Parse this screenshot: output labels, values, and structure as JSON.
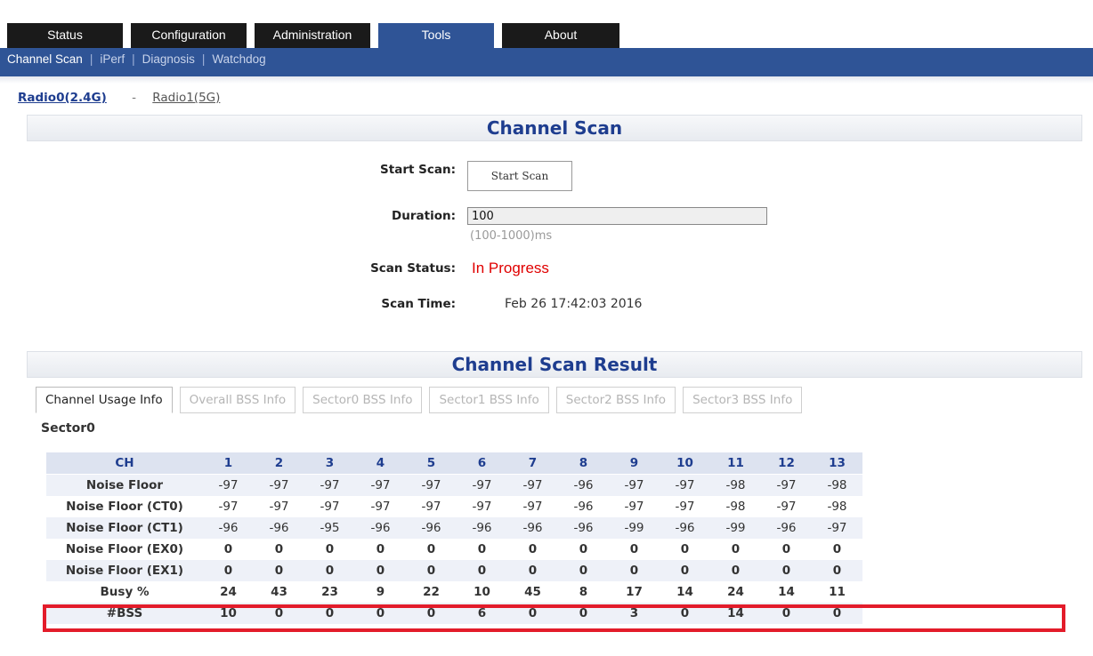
{
  "nav": {
    "tabs": [
      {
        "label": "Status"
      },
      {
        "label": "Configuration"
      },
      {
        "label": "Administration"
      },
      {
        "label": "Tools"
      },
      {
        "label": "About"
      }
    ],
    "active_tab": "Tools",
    "subnav": [
      "Channel Scan",
      "iPerf",
      "Diagnosis",
      "Watchdog"
    ],
    "subnav_sep": "|"
  },
  "radios": {
    "radio0": "Radio0(2.4G)",
    "sep": "-",
    "radio1": "Radio1(5G)"
  },
  "scan": {
    "header": "Channel Scan",
    "start_label": "Start Scan:",
    "start_button": "Start Scan",
    "duration_label": "Duration:",
    "duration_value": "100",
    "duration_hint": "(100-1000)ms",
    "status_label": "Scan Status:",
    "status_value": "In Progress",
    "time_label": "Scan Time:",
    "time_value": "Feb 26 17:42:03 2016"
  },
  "result": {
    "header": "Channel Scan Result",
    "tabs": [
      "Channel Usage Info",
      "Overall BSS Info",
      "Sector0 BSS Info",
      "Sector1 BSS Info",
      "Sector2 BSS Info",
      "Sector3 BSS Info"
    ],
    "sector": "Sector0",
    "table": {
      "header_label": "CH",
      "channels": [
        "1",
        "2",
        "3",
        "4",
        "5",
        "6",
        "7",
        "8",
        "9",
        "10",
        "11",
        "12",
        "13"
      ],
      "rows": [
        {
          "label": "Noise Floor",
          "values": [
            "-97",
            "-97",
            "-97",
            "-97",
            "-97",
            "-97",
            "-97",
            "-96",
            "-97",
            "-97",
            "-98",
            "-97",
            "-98"
          ]
        },
        {
          "label": "Noise Floor (CT0)",
          "values": [
            "-97",
            "-97",
            "-97",
            "-97",
            "-97",
            "-97",
            "-97",
            "-96",
            "-97",
            "-97",
            "-98",
            "-97",
            "-98"
          ]
        },
        {
          "label": "Noise Floor (CT1)",
          "values": [
            "-96",
            "-96",
            "-95",
            "-96",
            "-96",
            "-96",
            "-96",
            "-96",
            "-99",
            "-96",
            "-99",
            "-96",
            "-97"
          ]
        },
        {
          "label": "Noise Floor (EX0)",
          "values": [
            "0",
            "0",
            "0",
            "0",
            "0",
            "0",
            "0",
            "0",
            "0",
            "0",
            "0",
            "0",
            "0"
          ]
        },
        {
          "label": "Noise Floor (EX1)",
          "values": [
            "0",
            "0",
            "0",
            "0",
            "0",
            "0",
            "0",
            "0",
            "0",
            "0",
            "0",
            "0",
            "0"
          ]
        },
        {
          "label": "Busy %",
          "values": [
            "24",
            "43",
            "23",
            "9",
            "22",
            "10",
            "45",
            "8",
            "17",
            "14",
            "24",
            "14",
            "11"
          ]
        },
        {
          "label": "#BSS",
          "values": [
            "10",
            "0",
            "0",
            "0",
            "0",
            "6",
            "0",
            "0",
            "3",
            "0",
            "14",
            "0",
            "0"
          ]
        }
      ]
    }
  },
  "colors": {
    "nav_blue": "#2f5496",
    "highlight_red": "#e31c2a",
    "status_red": "#e00000"
  }
}
